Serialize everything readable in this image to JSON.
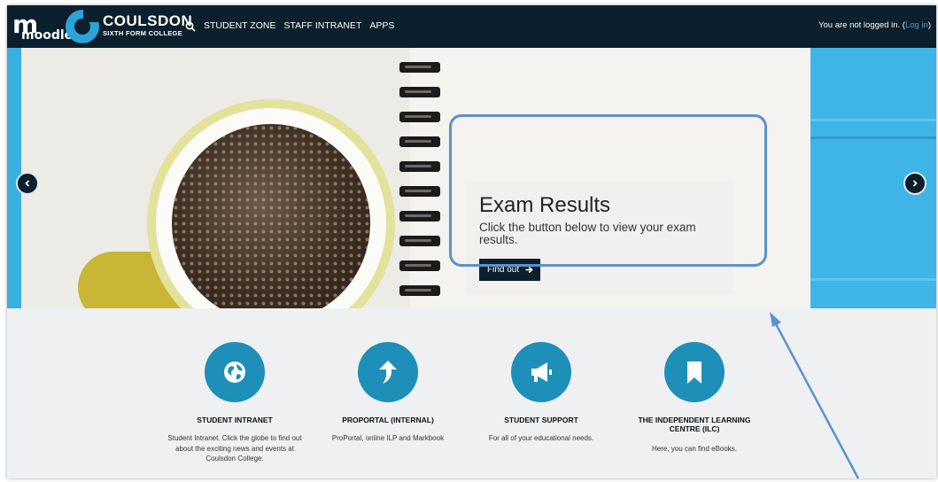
{
  "navbar": {
    "moodle_logo_text": "moodle",
    "college_name": "COULSDON",
    "college_subtitle": "SIXTH FORM COLLEGE",
    "links": [
      "STUDENT ZONE",
      "STAFF INTRANET",
      "APPS"
    ],
    "login_prefix": "You are not logged in. (",
    "login_link": "Log in",
    "login_suffix": ")"
  },
  "slide": {
    "title": "Exam Results",
    "text": "Click the button below to view your exam results.",
    "button_label": "Find out"
  },
  "tiles": [
    {
      "title": "STUDENT INTRANET",
      "desc": "Student Intranet. Click the globe to find out about the exciting news and events at Coulsdon College.",
      "icon": "globe-icon"
    },
    {
      "title": "PROPORTAL (INTERNAL)",
      "desc": "ProPortal, online ILP and Markbook",
      "icon": "arrow-up-icon"
    },
    {
      "title": "STUDENT SUPPORT",
      "desc": "For all of your educational needs.",
      "icon": "megaphone-icon"
    },
    {
      "title": "THE INDEPENDENT LEARNING CENTRE (ILC)",
      "desc": "Here, you can find eBooks.",
      "icon": "bookmark-icon"
    }
  ],
  "colors": {
    "navbar": "#0c1f2c",
    "accent": "#1e8fb8",
    "highlight": "#5b92cd",
    "link": "#4a9bd1"
  }
}
